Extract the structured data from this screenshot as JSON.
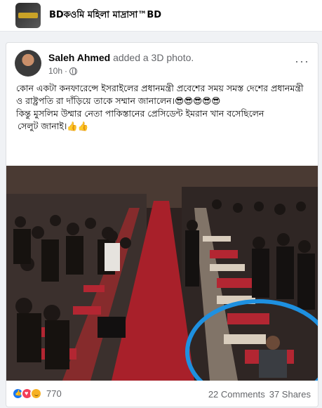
{
  "group": {
    "name": "BDকওমি মহিলা মাদ্রাসা™BD"
  },
  "post": {
    "author": "Saleh Ahmed",
    "action": "added a 3D photo.",
    "time": "10h",
    "time_separator": "·",
    "more": "···",
    "text_line1": "কোন একটা কনফারেন্সে ইসরাইলের প্রধানমন্ত্রী প্রবেশের সময় সমস্ত দেশের প্রধানমন্ত্রী ও রাষ্ট্রপতি রা দাঁড়িয়ে তাকে সম্মান জানালেন।😎😎😎😎😎",
    "text_line2": "কিন্তু মুসলিম উম্মার নেতা পাকিস্তানের প্রেসিডেন্ট ইমরান খান বসেছিলেন",
    "text_line3": "সেলুট জানাই।👍👍"
  },
  "footer": {
    "reaction_count": "770",
    "comments": "22 Comments",
    "shares": "37 Shares"
  },
  "colors": {
    "accent": "#1877f2",
    "highlight_circle": "#1e90e0",
    "carpet": "#a8202a",
    "chair": "#b32632"
  }
}
